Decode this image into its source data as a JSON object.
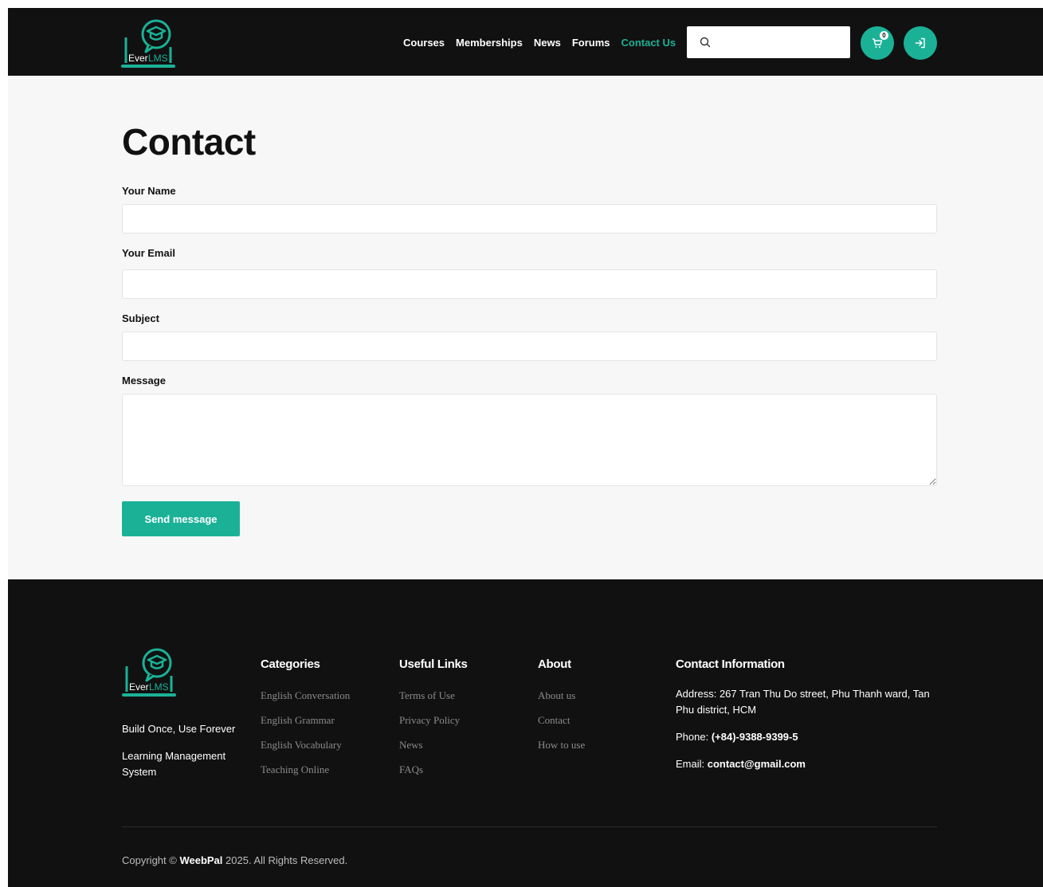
{
  "colors": {
    "accent": "#1bb197",
    "header_bg": "#111111",
    "page_bg": "#f7f7f7"
  },
  "brand": {
    "logo_text_1": "Ever",
    "logo_text_2": "LMS"
  },
  "nav": {
    "items": [
      {
        "label": "Courses",
        "active": false
      },
      {
        "label": "Memberships",
        "active": false
      },
      {
        "label": "News",
        "active": false
      },
      {
        "label": "Forums",
        "active": false
      },
      {
        "label": "Contact Us",
        "active": true
      }
    ]
  },
  "search": {
    "value": "",
    "icon": "search-icon"
  },
  "cart": {
    "count": "0",
    "icon": "cart-icon"
  },
  "login": {
    "icon": "login-icon"
  },
  "main": {
    "title": "Contact",
    "form": {
      "name_label": "Your Name",
      "name_value": "",
      "email_label": "Your Email",
      "email_value": "",
      "subject_label": "Subject",
      "subject_value": "",
      "message_label": "Message",
      "message_value": "",
      "submit_label": "Send message"
    }
  },
  "footer": {
    "tagline_1": "Build Once, Use Forever",
    "tagline_2": "Learning Management System",
    "categories": {
      "heading": "Categories",
      "items": [
        "English Conversation",
        "English Grammar",
        "English Vocabulary",
        "Teaching Online"
      ]
    },
    "useful_links": {
      "heading": "Useful Links",
      "items": [
        "Terms of Use",
        "Privacy Policy",
        "News",
        "FAQs"
      ]
    },
    "about": {
      "heading": "About",
      "items": [
        "About us",
        "Contact",
        "How to use"
      ]
    },
    "contact": {
      "heading": "Contact Information",
      "address_label": "Address:",
      "address": "267 Tran Thu Do street, Phu Thanh ward, Tan Phu district, HCM",
      "phone_label": "Phone:",
      "phone": "(+84)-9388-9399-5",
      "email_label": "Email:",
      "email": "contact@gmail.com"
    },
    "copyright": {
      "prefix": "Copyright ©",
      "company": "WeebPal",
      "suffix": "2025. All Rights Reserved."
    }
  }
}
